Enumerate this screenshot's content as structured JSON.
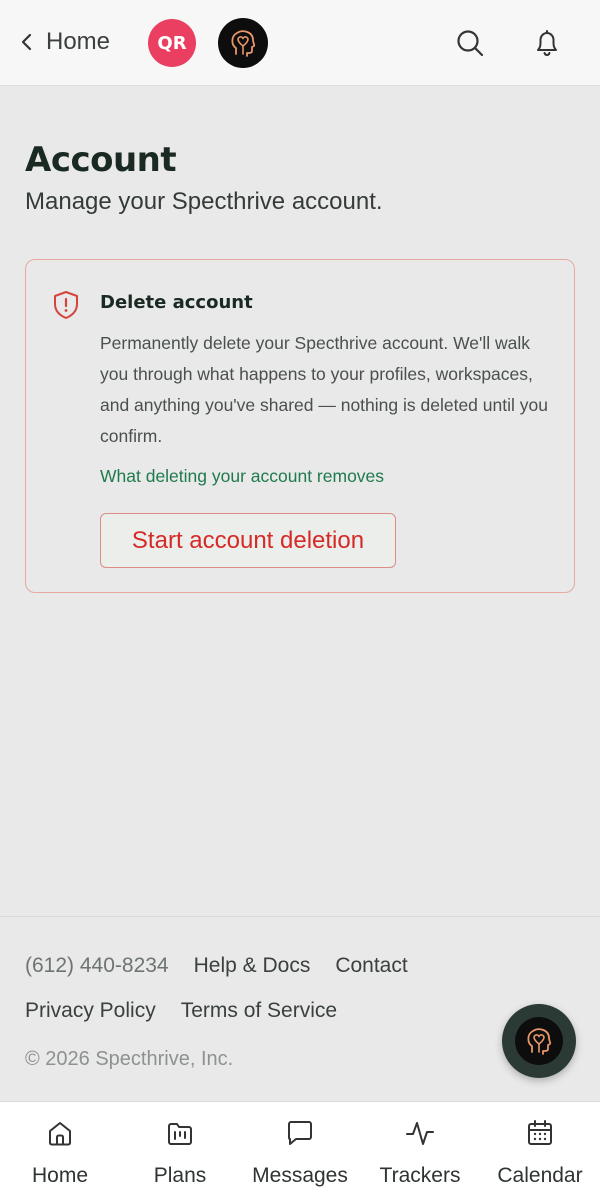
{
  "header": {
    "back_label": "Home",
    "avatar_initials": "QR",
    "colors": {
      "avatar_bg": "#ea3f60",
      "logo_bg": "#0d0d0d",
      "logo_stroke": "#e8976a"
    }
  },
  "page": {
    "title": "Account",
    "subtitle": "Manage your Specthrive account."
  },
  "delete_card": {
    "icon": "shield-alert-icon",
    "title": "Delete account",
    "description": "Permanently delete your Specthrive account. We'll walk you through what happens to your profiles, workspaces, and anything you've shared — nothing is deleted until you confirm.",
    "link": "What deleting your account removes",
    "button": "Start account deletion",
    "colors": {
      "border": "#e7a9a2",
      "danger": "#d52a26",
      "link": "#1f7a4d"
    }
  },
  "footer": {
    "phone": "(612) 440-8234",
    "help": "Help & Docs",
    "contact": "Contact",
    "privacy": "Privacy Policy",
    "terms": "Terms of Service",
    "copyright": "© 2026 Specthrive, Inc."
  },
  "bottom_nav": [
    {
      "label": "Home",
      "icon": "home-icon"
    },
    {
      "label": "Plans",
      "icon": "folder-plans-icon"
    },
    {
      "label": "Messages",
      "icon": "message-icon"
    },
    {
      "label": "Trackers",
      "icon": "activity-icon"
    },
    {
      "label": "Calendar",
      "icon": "calendar-icon"
    }
  ]
}
